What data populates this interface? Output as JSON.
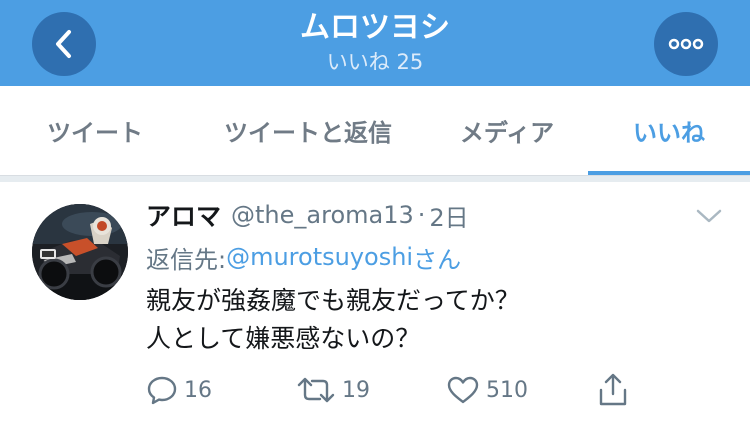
{
  "header": {
    "title": "ムロツヨシ",
    "subtitle": "いいね 25",
    "back_icon": "chevron-left-icon",
    "more_icon": "more-horizontal-icon"
  },
  "tabs": [
    {
      "label": "ツイート",
      "active": false
    },
    {
      "label": "ツイートと返信",
      "active": false
    },
    {
      "label": "メディア",
      "active": false
    },
    {
      "label": "いいね",
      "active": true
    }
  ],
  "tweet": {
    "author_name": "アロマ",
    "author_handle": "@the_aroma13",
    "separator": "·",
    "time": "2日",
    "reply": {
      "prefix": "返信先: ",
      "mention": "@murotsuyoshi",
      "suffix": "さん"
    },
    "text_lines": [
      "親友が強姦魔でも親友だってか？",
      "人として嫌悪感ないの？"
    ],
    "actions": {
      "reply_count": "16",
      "retweet_count": "19",
      "like_count": "510"
    }
  },
  "colors": {
    "accent": "#4c9ee3",
    "header_button": "#2f6fb0",
    "secondary_text": "#657786"
  }
}
